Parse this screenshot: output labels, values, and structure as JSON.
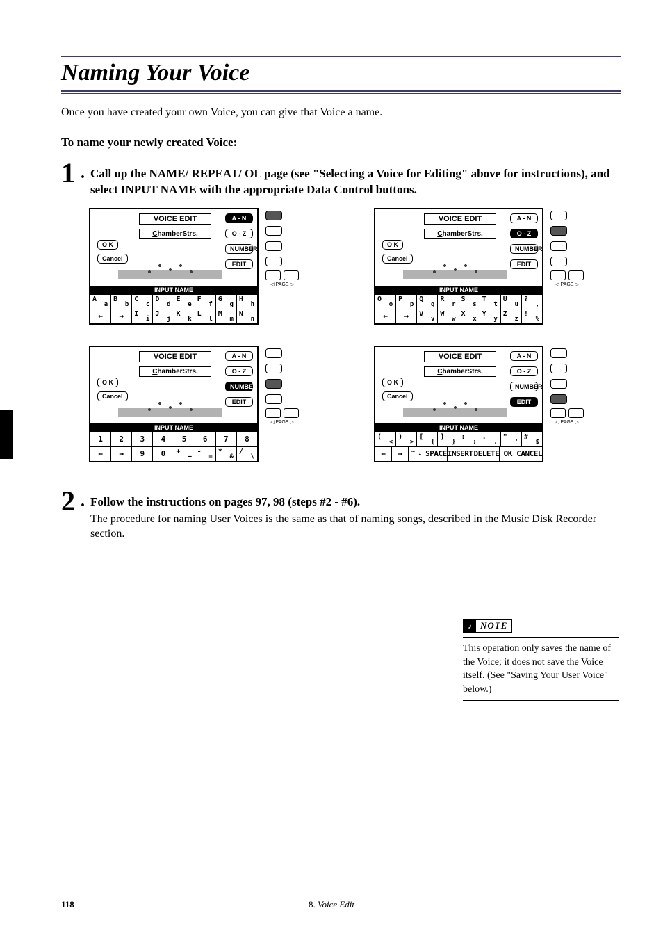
{
  "title": "Naming Your Voice",
  "intro": "Once you have created your own Voice, you can give that Voice a name.",
  "subhead": "To name your newly created Voice:",
  "step1": {
    "num": "1",
    "text": "Call up the NAME/ REPEAT/ OL page (see \"Selecting a Voice for Editing\" above for instructions), and select INPUT NAME with the appropriate Data Control buttons."
  },
  "step2": {
    "num": "2",
    "heading": "Follow the instructions on pages 97, 98 (steps #2 - #6).",
    "body": "The procedure for naming User Voices is the same as that of naming songs, described in the Music Disk Recorder section."
  },
  "lcd_common": {
    "title": "VOICE EDIT",
    "voice_name": "ChamberStrs.",
    "ok": "O K",
    "cancel": "Cancel",
    "input_bar": "INPUT NAME",
    "right": {
      "an": "A - N",
      "oz": "O - Z",
      "number": "NUMBER",
      "edit": "EDIT"
    },
    "page_label": "◁ PAGE ▷"
  },
  "screens": [
    {
      "selected_right": "an",
      "selected_side": 0,
      "rows": [
        [
          {
            "m": "A",
            "s": "a"
          },
          {
            "m": "B",
            "s": "b"
          },
          {
            "m": "C",
            "s": "c"
          },
          {
            "m": "D",
            "s": "d"
          },
          {
            "m": "E",
            "s": "e"
          },
          {
            "m": "F",
            "s": "f"
          },
          {
            "m": "G",
            "s": "g"
          },
          {
            "m": "H",
            "s": "h"
          }
        ],
        [
          {
            "only": "←"
          },
          {
            "only": "→"
          },
          {
            "m": "I",
            "s": "i"
          },
          {
            "m": "J",
            "s": "j"
          },
          {
            "m": "K",
            "s": "k"
          },
          {
            "m": "L",
            "s": "l"
          },
          {
            "m": "M",
            "s": "m"
          },
          {
            "m": "N",
            "s": "n"
          }
        ]
      ]
    },
    {
      "selected_right": "oz",
      "selected_side": 1,
      "rows": [
        [
          {
            "m": "O",
            "s": "o"
          },
          {
            "m": "P",
            "s": "p"
          },
          {
            "m": "Q",
            "s": "q"
          },
          {
            "m": "R",
            "s": "r"
          },
          {
            "m": "S",
            "s": "s"
          },
          {
            "m": "T",
            "s": "t"
          },
          {
            "m": "U",
            "s": "u"
          },
          {
            "m": "?",
            "s": ","
          }
        ],
        [
          {
            "only": "←"
          },
          {
            "only": "→"
          },
          {
            "m": "V",
            "s": "v"
          },
          {
            "m": "W",
            "s": "w"
          },
          {
            "m": "X",
            "s": "x"
          },
          {
            "m": "Y",
            "s": "y"
          },
          {
            "m": "Z",
            "s": "z"
          },
          {
            "m": "!",
            "s": "%"
          }
        ]
      ]
    },
    {
      "selected_right": "number",
      "selected_side": 2,
      "rows": [
        [
          {
            "only": "1"
          },
          {
            "only": "2"
          },
          {
            "only": "3"
          },
          {
            "only": "4"
          },
          {
            "only": "5"
          },
          {
            "only": "6"
          },
          {
            "only": "7"
          },
          {
            "only": "8"
          }
        ],
        [
          {
            "only": "←"
          },
          {
            "only": "→"
          },
          {
            "only": "9"
          },
          {
            "only": "0"
          },
          {
            "m": "+",
            "s": "–"
          },
          {
            "m": "-",
            "s": "="
          },
          {
            "m": "*",
            "s": "&"
          },
          {
            "m": "/",
            "s": "\\"
          }
        ]
      ]
    },
    {
      "selected_right": "edit",
      "selected_side": 3,
      "rows": [
        [
          {
            "m": "(",
            "s": "<"
          },
          {
            "m": ")",
            "s": ">"
          },
          {
            "m": "[",
            "s": "{"
          },
          {
            "m": "]",
            "s": "}"
          },
          {
            "m": ":",
            "s": ";"
          },
          {
            "m": ".",
            "s": ","
          },
          {
            "m": "\"",
            "s": "'"
          },
          {
            "m": "#",
            "s": "$"
          }
        ],
        [
          {
            "only": "←"
          },
          {
            "only": "→"
          },
          {
            "m": "~",
            "s": "^"
          },
          {
            "only": "SPACE",
            "tiny": true
          },
          {
            "only": "INSERT",
            "tiny": true
          },
          {
            "only": "DELETE",
            "tiny": true
          },
          {
            "only": "OK",
            "tiny": true
          },
          {
            "only": "CANCEL",
            "tiny": true
          }
        ]
      ]
    }
  ],
  "note": {
    "label": "NOTE",
    "text": "This operation only saves the name of the Voice; it does not save the Voice itself.  (See \"Saving Your User Voice\" below.)"
  },
  "footer": {
    "page": "118",
    "chapter_num": "8.",
    "chapter_title": "Voice Edit"
  }
}
